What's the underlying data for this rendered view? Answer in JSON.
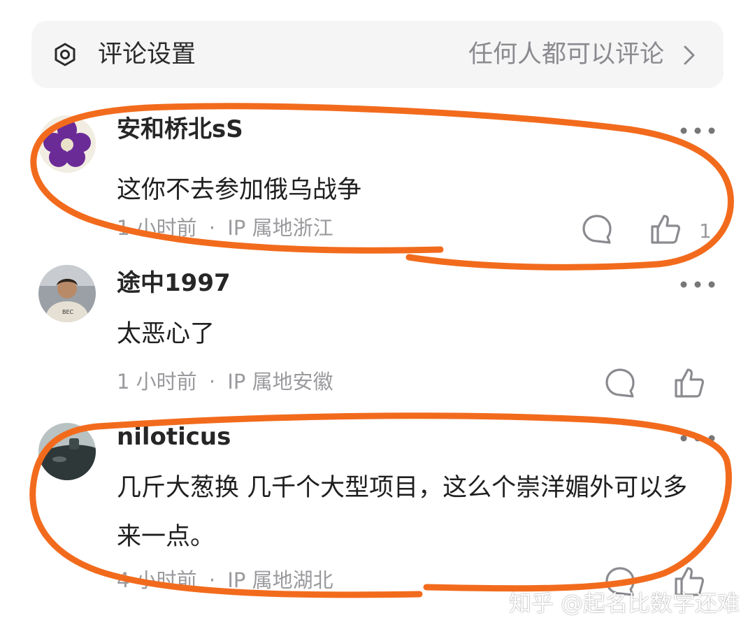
{
  "settings": {
    "icon": "settings-hexagon-icon",
    "label": "评论设置",
    "value": "任何人都可以评论"
  },
  "comments": [
    {
      "username": "安和桥北sS",
      "text": "这你不去参加俄乌战争",
      "time": "1 小时前",
      "ip": "IP 属地浙江",
      "like_count": "1",
      "avatar": {
        "type": "purple-flower",
        "colors": [
          "#6a2b97",
          "#e9e2c9"
        ]
      }
    },
    {
      "username": "途中1997",
      "text": "太恶心了",
      "time": "1 小时前",
      "ip": "IP 属地安徽",
      "like_count": "",
      "avatar": {
        "type": "person-photo",
        "colors": [
          "#8a8f96",
          "#e6e0d4"
        ]
      }
    },
    {
      "username": "niloticus",
      "text": "几斤大葱换 几千个大型项目，这么个崇洋媚外可以多来一点。",
      "time": "4 小时前",
      "ip": "IP 属地湖北",
      "like_count": "",
      "avatar": {
        "type": "submarine-photo",
        "colors": [
          "#3e4a4a",
          "#b9c2c2"
        ]
      }
    }
  ],
  "separator": "·",
  "watermark": "知乎 @起名比数字还难",
  "colors": {
    "annotation": "#f26b1d",
    "meta": "#9a9a9e",
    "settings_bg": "#f5f5f6"
  }
}
